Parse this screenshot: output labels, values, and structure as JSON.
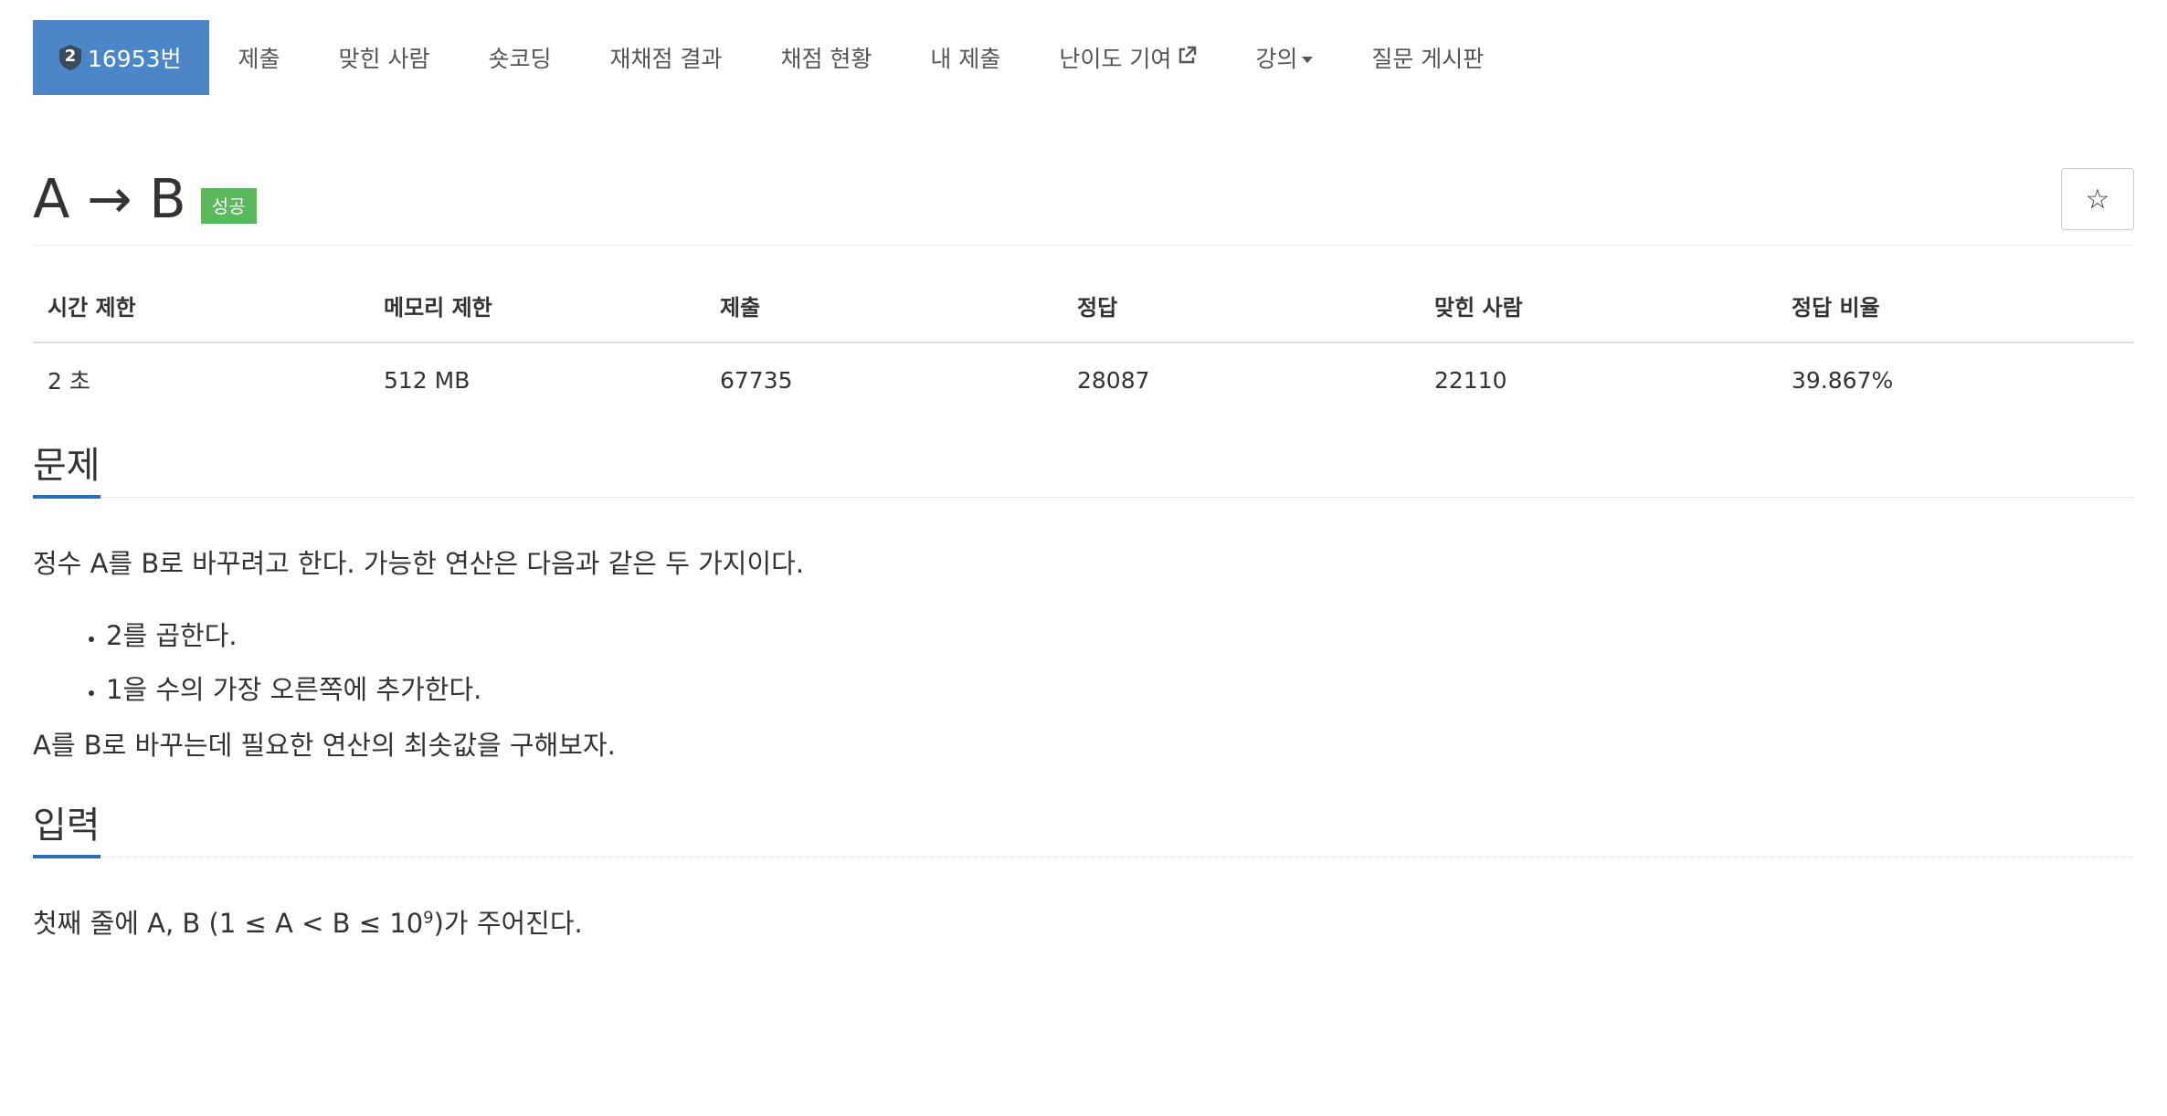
{
  "nav": {
    "problem_number": "16953번",
    "tier_badge": "2",
    "tier_color": "#3c4b5c",
    "items": [
      {
        "label": "제출"
      },
      {
        "label": "맞힌 사람"
      },
      {
        "label": "숏코딩"
      },
      {
        "label": "재채점 결과"
      },
      {
        "label": "채점 현황"
      },
      {
        "label": "내 제출"
      },
      {
        "label": "난이도 기여",
        "icon": "external-link-icon"
      },
      {
        "label": "강의",
        "icon": "caret-down-icon"
      },
      {
        "label": "질문 게시판"
      }
    ],
    "active_color": "#4a86c8"
  },
  "problem": {
    "title": "A → B",
    "status": "성공",
    "status_color": "#5cb85c",
    "star_icon": "☆"
  },
  "info_table": {
    "headers": [
      "시간 제한",
      "메모리 제한",
      "제출",
      "정답",
      "맞힌 사람",
      "정답 비율"
    ],
    "values": [
      "2 초",
      "512 MB",
      "67735",
      "28087",
      "22110",
      "39.867%"
    ]
  },
  "description": {
    "heading": "문제",
    "intro": "정수 A를 B로 바꾸려고 한다. 가능한 연산은 다음과 같은 두 가지이다.",
    "operations": [
      "2를 곱한다.",
      "1을 수의 가장 오른쪽에 추가한다."
    ],
    "outro": "A를 B로 바꾸는데 필요한 연산의 최솟값을 구해보자."
  },
  "input": {
    "heading": "입력",
    "text_before": "첫째 줄에 A, B (1 ≤ A < B ≤ 10",
    "superscript": "9",
    "text_after": ")가 주어진다."
  }
}
